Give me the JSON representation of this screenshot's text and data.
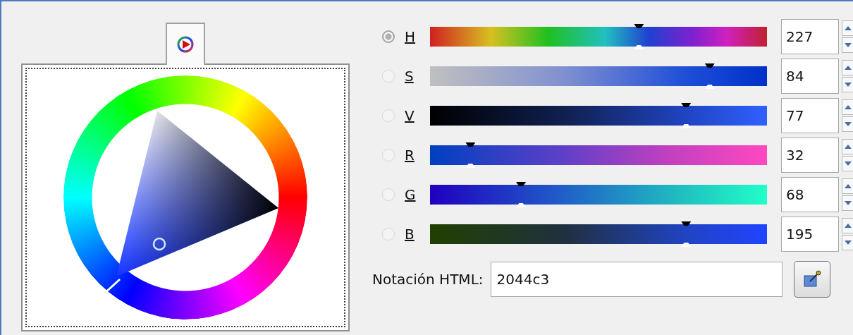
{
  "tab": {
    "selected": true
  },
  "channels": [
    {
      "kind": "h",
      "label": "H",
      "selected": true,
      "level": 0.62,
      "value": "227"
    },
    {
      "kind": "s",
      "label": "S",
      "selected": false,
      "level": 0.83,
      "value": "84"
    },
    {
      "kind": "v",
      "label": "V",
      "selected": false,
      "level": 0.76,
      "value": "77"
    },
    {
      "kind": "r",
      "label": "R",
      "selected": false,
      "level": 0.12,
      "value": "32"
    },
    {
      "kind": "g",
      "label": "G",
      "selected": false,
      "level": 0.27,
      "value": "68"
    },
    {
      "kind": "b",
      "label": "B",
      "selected": false,
      "level": 0.76,
      "value": "195"
    }
  ],
  "html_notation": {
    "label": "Notación HTML:",
    "value": "2044c3"
  }
}
